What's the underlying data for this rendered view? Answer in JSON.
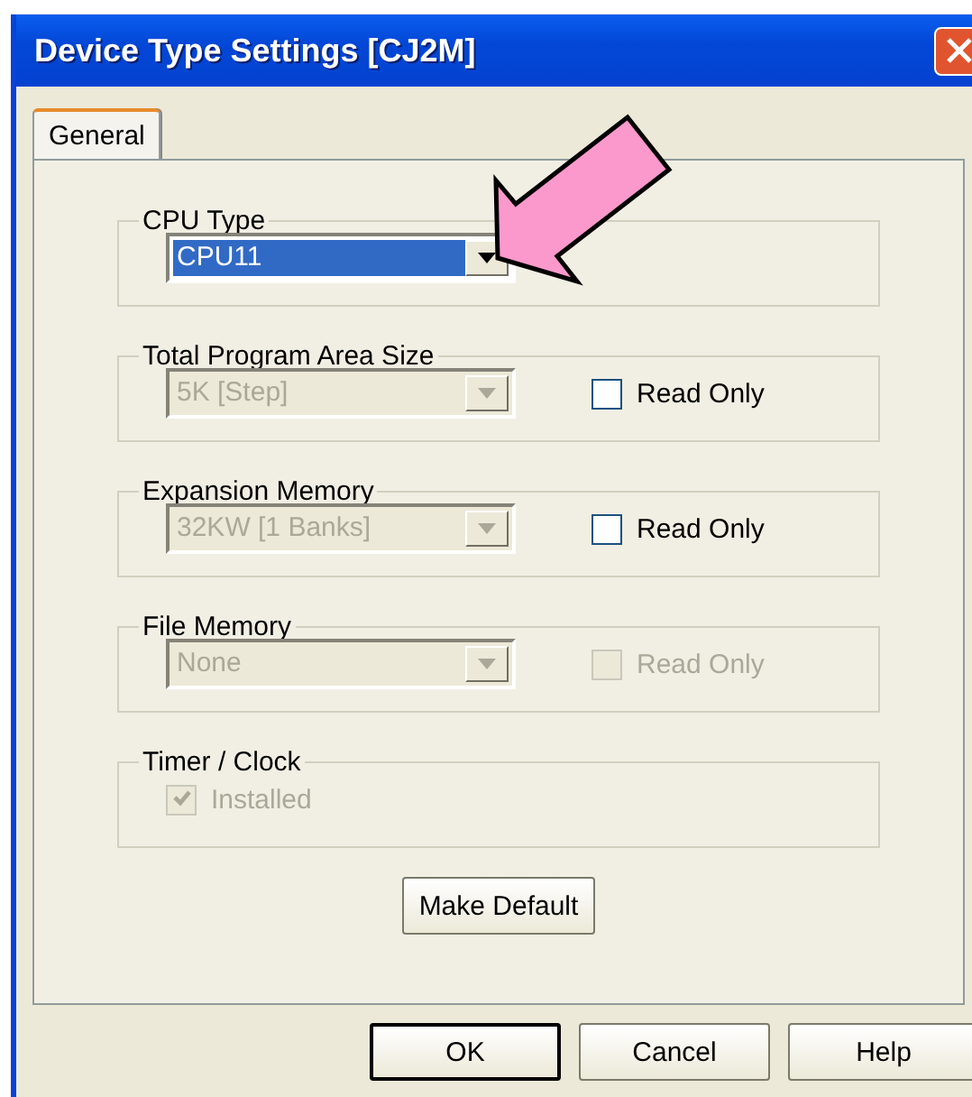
{
  "window": {
    "title": "Device Type Settings [CJ2M]"
  },
  "tabs": [
    {
      "label": "General",
      "selected": true
    }
  ],
  "groups": [
    {
      "title": "CPU Type",
      "combo": {
        "value": "CPU11",
        "disabled": false,
        "highlighted": true
      }
    },
    {
      "title": "Total Program Area Size",
      "combo": {
        "value": "5K [Step]",
        "disabled": true,
        "highlighted": false
      },
      "checkbox": {
        "label": "Read Only",
        "checked": false,
        "disabled": false
      }
    },
    {
      "title": "Expansion Memory",
      "combo": {
        "value": "32KW [1 Banks]",
        "disabled": true,
        "highlighted": false
      },
      "checkbox": {
        "label": "Read Only",
        "checked": false,
        "disabled": false
      }
    },
    {
      "title": "File Memory",
      "combo": {
        "value": "None",
        "disabled": true,
        "highlighted": false
      },
      "checkbox": {
        "label": "Read Only",
        "checked": false,
        "disabled": true
      }
    },
    {
      "title": "Timer / Clock",
      "checkbox": {
        "label": "Installed",
        "checked": true,
        "disabled": true
      }
    }
  ],
  "make_default_button": "Make Default",
  "buttons": [
    {
      "label": "OK",
      "default": true
    },
    {
      "label": "Cancel",
      "default": false
    },
    {
      "label": "Help",
      "default": false
    }
  ]
}
